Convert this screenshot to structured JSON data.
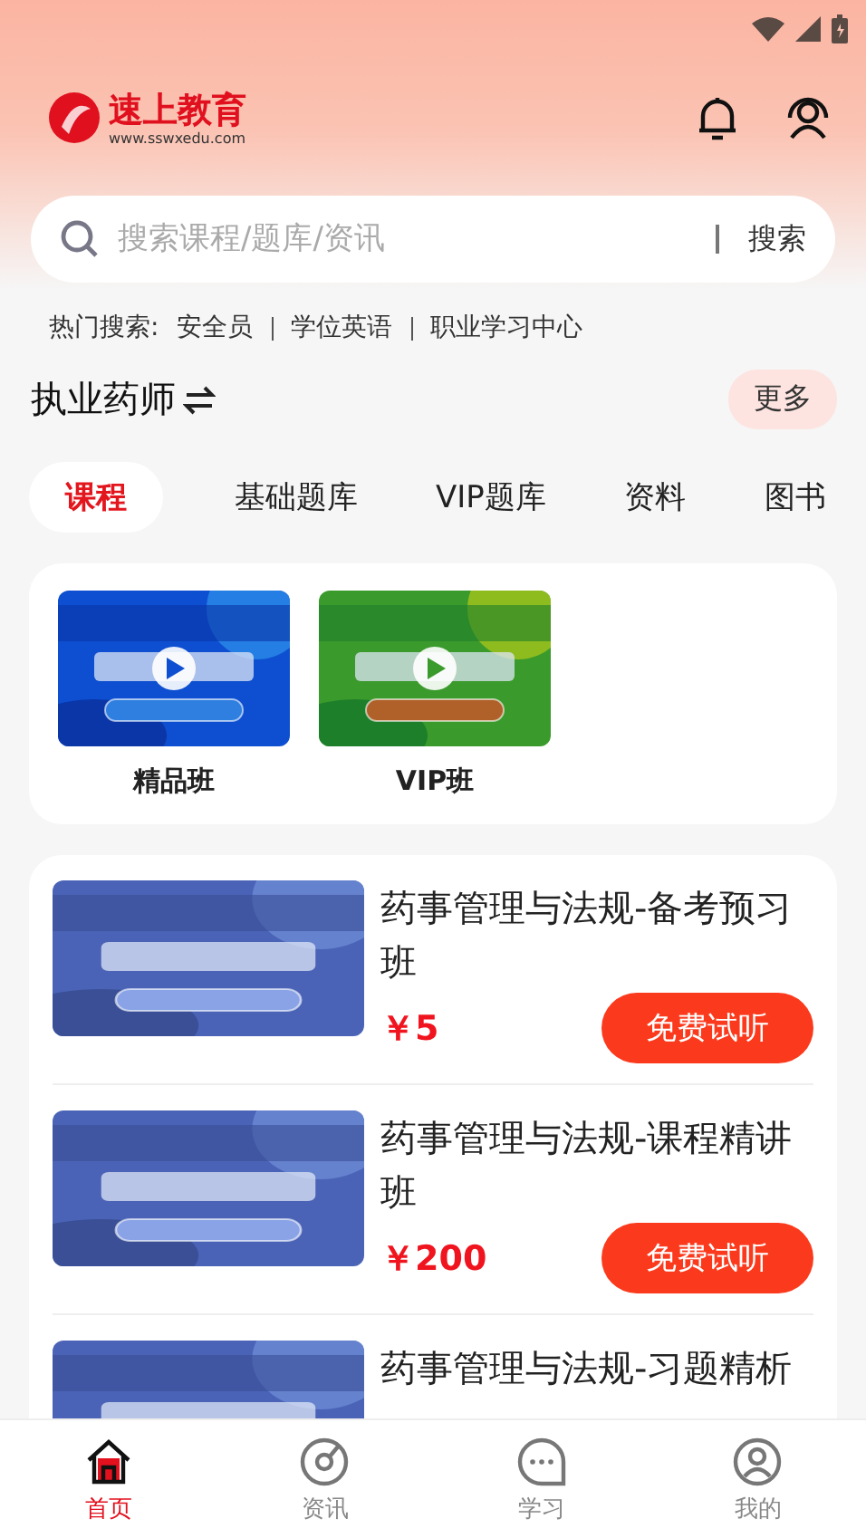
{
  "header": {
    "brand": "速上教育",
    "url": "www.sswxedu.com"
  },
  "search": {
    "placeholder": "搜索课程/题库/资讯",
    "button": "搜索"
  },
  "hot": {
    "label": "热门搜索:",
    "items": [
      "安全员",
      "学位英语",
      "职业学习中心"
    ]
  },
  "subject": {
    "title": "执业药师",
    "more": "更多"
  },
  "tabs": [
    {
      "label": "课程",
      "selected": true
    },
    {
      "label": "基础题库",
      "selected": false
    },
    {
      "label": "VIP题库",
      "selected": false
    },
    {
      "label": "资料",
      "selected": false
    },
    {
      "label": "图书",
      "selected": false
    }
  ],
  "categories": [
    {
      "label": "精品班",
      "kind": "blue"
    },
    {
      "label": "VIP班",
      "kind": "green"
    }
  ],
  "courses": [
    {
      "title": "药事管理与法规-备考预习班",
      "price": "￥5",
      "action": "免费试听"
    },
    {
      "title": "药事管理与法规-课程精讲班",
      "price": "￥200",
      "action": "免费试听"
    },
    {
      "title": "药事管理与法规-习题精析"
    }
  ],
  "nav": [
    {
      "label": "首页",
      "selected": true
    },
    {
      "label": "资讯",
      "selected": false
    },
    {
      "label": "学习",
      "selected": false
    },
    {
      "label": "我的",
      "selected": false
    }
  ]
}
